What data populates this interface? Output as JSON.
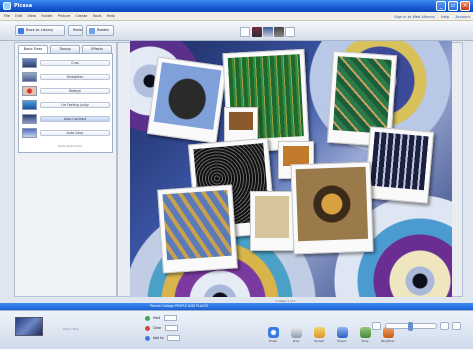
{
  "window": {
    "title": "Picasa"
  },
  "menu": {
    "items": [
      "File",
      "Edit",
      "View",
      "Folder",
      "Picture",
      "Create",
      "Tools",
      "Help"
    ],
    "right_links": [
      "Sign in to Web Albums",
      "Help",
      "Account"
    ]
  },
  "toolbar": {
    "back_label": "Back to Library",
    "redo_label": "Redo",
    "button3_label": "Rotate"
  },
  "panel": {
    "tabs": [
      "Basic Fixes",
      "Tuning",
      "Effects"
    ],
    "effects": [
      "Crop",
      "Straighten",
      "Redeye",
      "I'm Feeling Lucky",
      "Auto Contrast",
      "Auto Color"
    ],
    "footer": "Undo Auto Color"
  },
  "viewer": {
    "caption": "Collage 1 of 1"
  },
  "tray": {
    "header": "Picture Collage  PEOPLE AND PLACES",
    "label": "Photo Tray",
    "rows": [
      "Hold",
      "Clear",
      "Add to"
    ],
    "actions": [
      "Email",
      "Print",
      "Upload",
      "Export",
      "Shop",
      "BlogThis!"
    ]
  },
  "colors": {
    "titlebar": "#1a5fd6",
    "accent": "#3c8bf0"
  }
}
